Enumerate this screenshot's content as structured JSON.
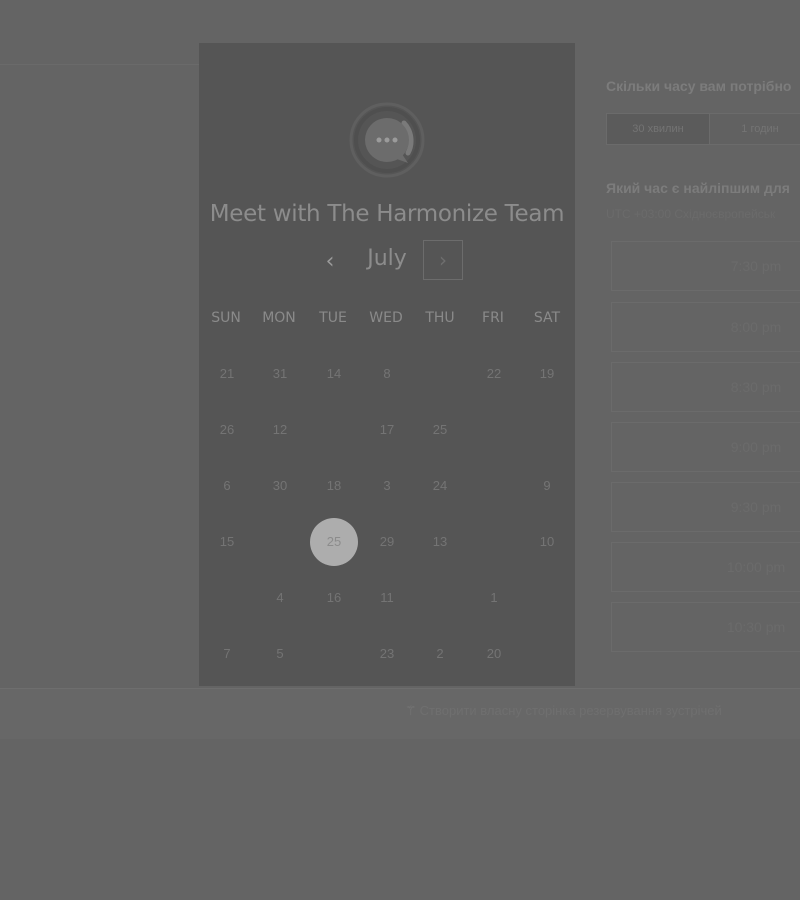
{
  "card": {
    "title": "Meet with The Harmonize Team",
    "month": "July",
    "prev_icon": "chevron-left-icon",
    "next_icon": "chevron-right-icon",
    "weekdays": [
      "SUN",
      "MON",
      "TUE",
      "WED",
      "THU",
      "FRI",
      "SAT"
    ],
    "days": [
      [
        "21",
        "31",
        "14",
        "8",
        "",
        "22",
        "19"
      ],
      [
        "26",
        "12",
        "",
        "17",
        "25",
        "",
        ""
      ],
      [
        "6",
        "30",
        "18",
        "3",
        "24",
        "",
        "9"
      ],
      [
        "15",
        "",
        "25",
        "29",
        "13",
        "",
        "10"
      ],
      [
        "",
        "4",
        "16",
        "11",
        "",
        "1",
        ""
      ],
      [
        "7",
        "5",
        "",
        "23",
        "2",
        "20",
        ""
      ]
    ],
    "selected_day": "25"
  },
  "right": {
    "duration_question": "Скільки часу вам потрібно",
    "duration_options": [
      "30 хвилин",
      "1 годин"
    ],
    "time_question": "Який час є найліпшим для",
    "timezone": "UTC +03:00 Східноєвропейськ",
    "slots": [
      "7:30 pm",
      "8:00 pm",
      "8:30 pm",
      "9:00 pm",
      "9:30 pm",
      "10:00 pm",
      "10:30 pm"
    ]
  },
  "footer": {
    "link": "Створити власну сторінка резервування зустрічей"
  },
  "colors": {
    "overlay": "#646464",
    "card": "#555555",
    "selected": "#adadad"
  }
}
